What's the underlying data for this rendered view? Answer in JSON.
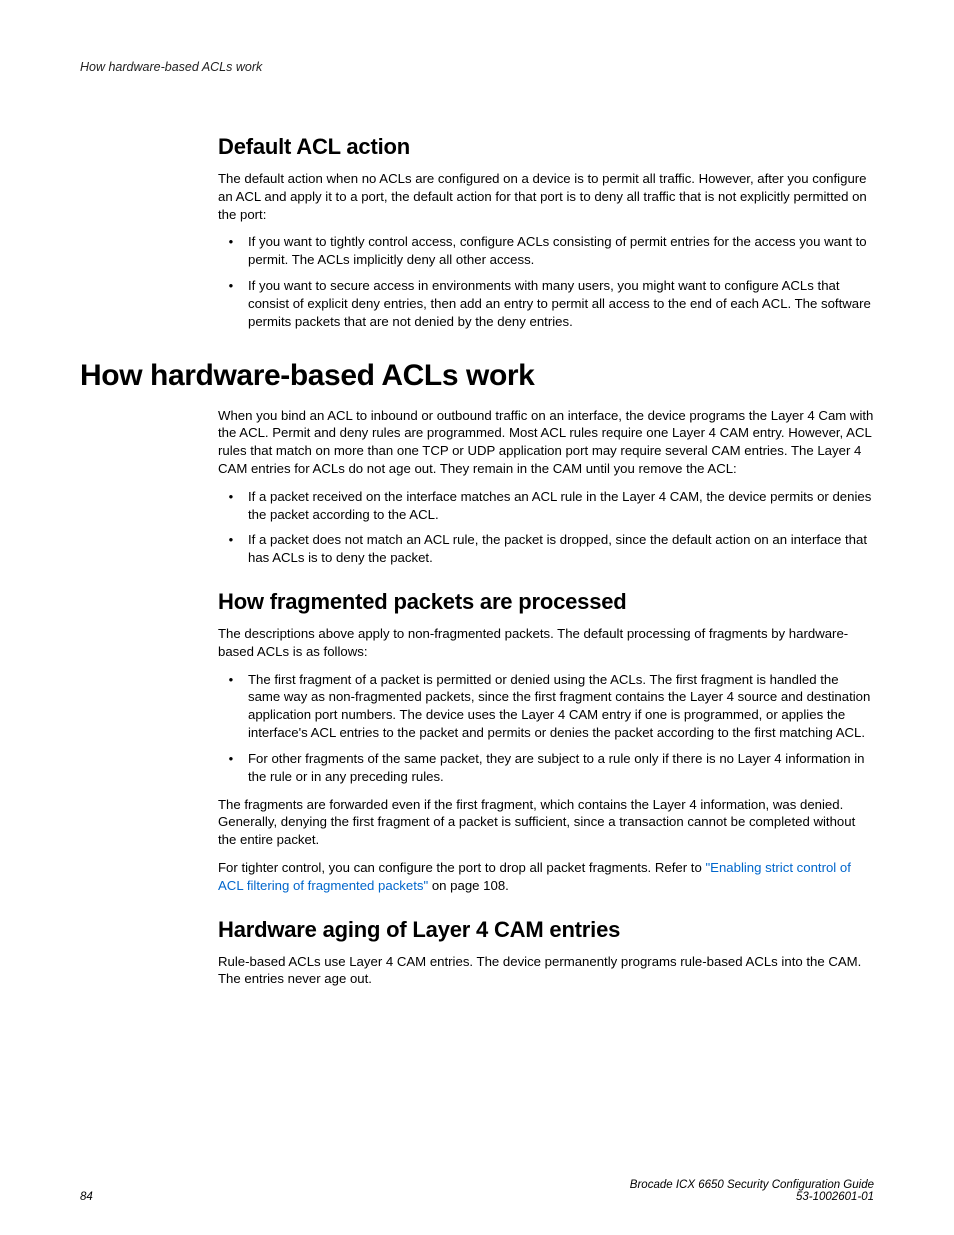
{
  "runningHeader": "How hardware-based ACLs work",
  "section1": {
    "heading": "Default ACL action",
    "intro": "The default action when no ACLs are configured on a device is to permit all traffic. However, after you configure an ACL and apply it to a port, the default action for that port is to deny all traffic that is not explicitly permitted on the port:",
    "bullets": [
      "If you want to tightly control access, configure ACLs consisting of permit entries for the access you want to permit. The ACLs implicitly deny all other access.",
      "If you want to secure access in environments with many users, you might want to configure ACLs that consist of explicit deny entries, then add an entry to permit all access to the end of each ACL. The software permits packets that are not denied by the deny entries."
    ]
  },
  "section2": {
    "heading": "How hardware-based ACLs work",
    "intro": "When you bind an ACL to inbound or outbound traffic on an interface, the device programs the Layer 4 Cam with the ACL. Permit and deny rules are programmed. Most ACL rules require one Layer 4 CAM entry. However, ACL rules that match on more than one TCP or UDP application port may require several CAM entries. The Layer 4 CAM entries for ACLs do not age out. They remain in the CAM until you remove the ACL:",
    "bullets": [
      "If a packet received on the interface matches an ACL rule in the Layer 4 CAM, the device permits or denies the packet according to the ACL.",
      "If a packet does not match an ACL rule, the packet is dropped, since the default action on an interface that has ACLs is to deny the packet."
    ]
  },
  "section3": {
    "heading": "How fragmented packets are processed",
    "intro": "The descriptions above apply to non-fragmented packets. The default processing of fragments by hardware-based ACLs is as follows:",
    "bullets": [
      "The first fragment of a packet is permitted or denied using the ACLs. The first fragment is handled the same way as non-fragmented packets, since the first fragment contains the Layer 4 source and destination application port numbers. The device uses the Layer 4 CAM entry if one is programmed, or applies the interface's ACL entries to the packet and permits or denies the packet according to the first matching ACL.",
      "For other fragments of the same packet, they are subject to a rule only if there is no Layer 4 information in the rule or in any preceding rules."
    ],
    "para1": "The fragments are forwarded even if the first fragment, which contains the Layer 4 information, was denied. Generally, denying the first fragment of a packet is sufficient, since a transaction cannot be completed without the entire packet.",
    "para2a": "For tighter control, you can configure the port to drop all packet fragments. Refer to ",
    "linkText": "\"Enabling strict control of ACL filtering of fragmented packets\"",
    "para2b": " on page 108."
  },
  "section4": {
    "heading": "Hardware aging of Layer 4 CAM entries",
    "para": "Rule-based ACLs use Layer 4 CAM entries. The device permanently programs rule-based ACLs into the CAM. The entries never age out."
  },
  "footer": {
    "pageNum": "84",
    "title": "Brocade ICX 6650 Security Configuration Guide",
    "docNum": "53-1002601-01"
  }
}
